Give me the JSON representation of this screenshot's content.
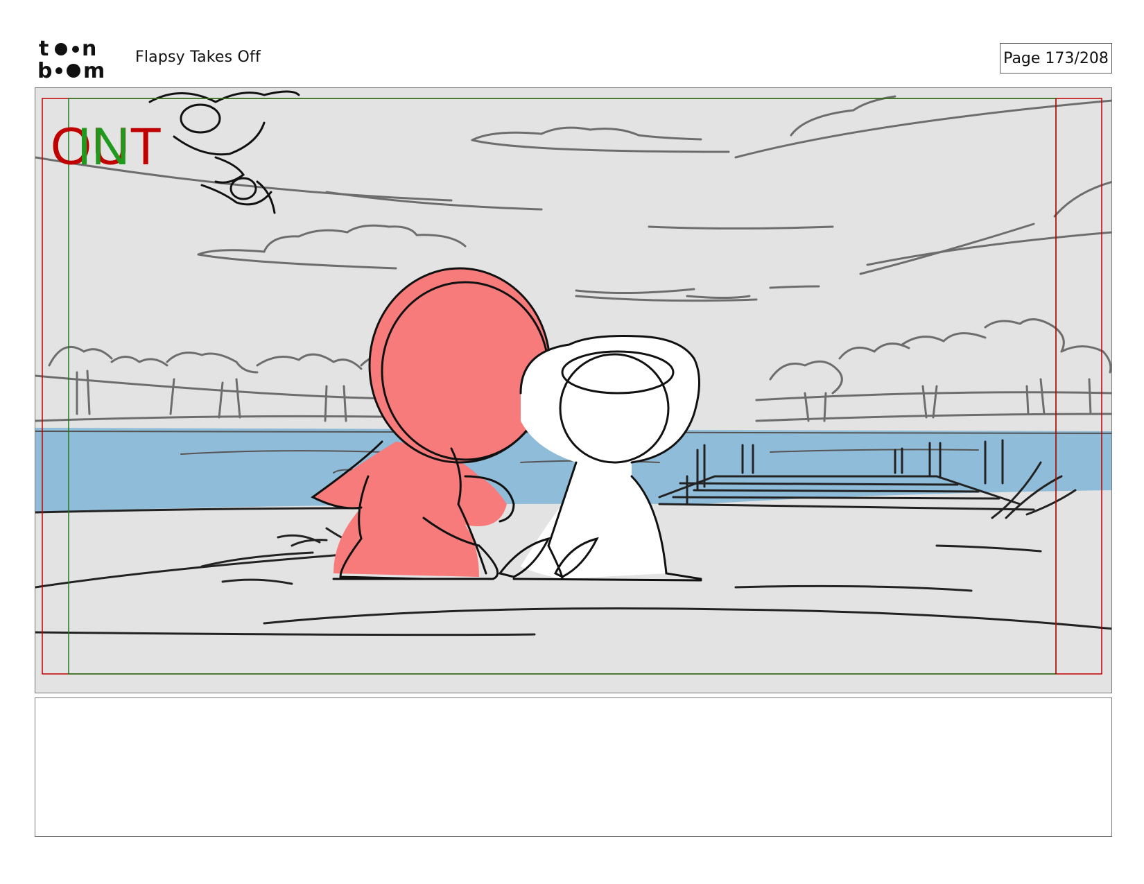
{
  "header": {
    "logo_text_top": "toon",
    "logo_text_bottom": "boom",
    "project_title": "Flapsy Takes Off",
    "page_label": "Page 173/208"
  },
  "panel": {
    "frame_label_in": "IN",
    "frame_label_out": "OUT",
    "colors": {
      "sky": "#e3e3e3",
      "water": "#8fbcd8",
      "character_red": "#f77b7b",
      "frame_out": "#c00000",
      "frame_in": "#1f7a1f"
    }
  },
  "notes": {
    "text": ""
  }
}
